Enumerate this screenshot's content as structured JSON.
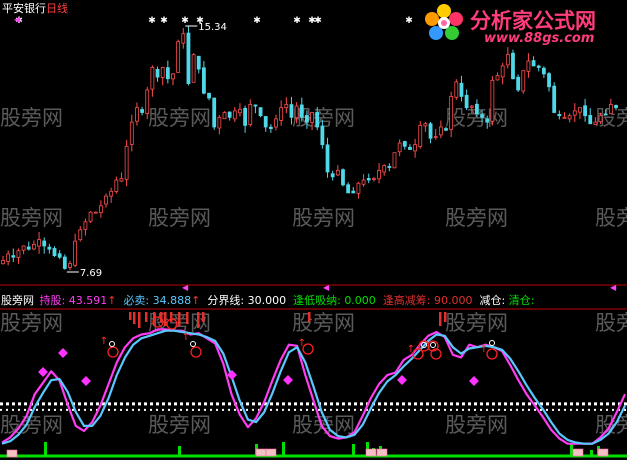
{
  "stock": {
    "name": "平安银行",
    "period": "日线"
  },
  "watermark": {
    "text": "股旁网"
  },
  "logo": {
    "title": "分析家公式网",
    "url": "www.88gs.com"
  },
  "indicator_bar": {
    "source": "股旁网",
    "chi_gu_label": "持股:",
    "chi_gu_value": "43.591",
    "bi_mai_label": "必卖:",
    "bi_mai_value": "34.888",
    "fen_jie_label": "分界线:",
    "fen_jie_value": "30.000",
    "feng_di_label": "逢低吸纳:",
    "feng_di_value": "0.000",
    "feng_gao_label": "逢高减筹:",
    "feng_gao_value": "90.000",
    "jian_cang_label": "减仓:",
    "qing_cang_label": "清仓:",
    "arrow": "↑"
  },
  "colors": {
    "up": "#ff4d4d",
    "down": "#4fd8e8",
    "chi_gu": "#ff3cf2",
    "bi_mai": "#5ac8ff",
    "feng_di": "#00e000",
    "feng_gao": "#e03030",
    "divider": "#c00000"
  },
  "chart_data": [
    {
      "type": "candlestick",
      "title": "",
      "annotations": [
        {
          "label": "15.34",
          "at": "high"
        },
        {
          "label": "7.69",
          "at": "low"
        }
      ],
      "price_range": [
        7.69,
        15.34
      ],
      "close": [
        8.05,
        8.25,
        8.15,
        8.35,
        8.5,
        8.4,
        8.55,
        8.7,
        8.5,
        8.4,
        8.2,
        8.15,
        7.8,
        7.95,
        8.65,
        9.0,
        9.25,
        9.55,
        9.55,
        9.75,
        10.05,
        10.2,
        10.55,
        10.6,
        11.6,
        12.35,
        12.8,
        12.65,
        13.35,
        14.05,
        13.75,
        14.05,
        13.7,
        13.85,
        14.85,
        15.1,
        13.55,
        14.45,
        14.0,
        13.25,
        13.1,
        12.2,
        12.5,
        12.65,
        12.5,
        12.7,
        12.75,
        12.25,
        12.9,
        12.85,
        12.55,
        12.2,
        12.15,
        12.45,
        12.8,
        12.9,
        12.5,
        12.85,
        12.5,
        12.35,
        12.65,
        12.2,
        11.65,
        10.8,
        10.65,
        10.85,
        10.4,
        10.15,
        10.15,
        10.45,
        10.55,
        10.55,
        10.6,
        10.85,
        11.0,
        10.95,
        11.4,
        11.7,
        11.6,
        11.5,
        11.65,
        12.25,
        12.3,
        11.85,
        11.9,
        12.2,
        12.1,
        13.15,
        13.6,
        13.15,
        12.8,
        12.85,
        12.6,
        12.5,
        12.35,
        13.65,
        13.8,
        14.1,
        14.45,
        13.7,
        13.35,
        13.95,
        14.25,
        14.1,
        14.05,
        13.85,
        13.45,
        12.65,
        12.55,
        12.5,
        12.55,
        12.7,
        12.8,
        12.55,
        12.3,
        12.35,
        12.55,
        12.6,
        12.9,
        12.8
      ]
    },
    {
      "type": "line",
      "title": "",
      "ylim": [
        0,
        100
      ],
      "reference_lines": {
        "fen_jie": 30,
        "feng_di": 0,
        "feng_gao": 90
      },
      "series": [
        {
          "name": "持股",
          "values": [
            2,
            6,
            13,
            23,
            40,
            49,
            58,
            51,
            32,
            15,
            11,
            18,
            31,
            48,
            65,
            77,
            84,
            87,
            88,
            91,
            91,
            90,
            90,
            87,
            88,
            84,
            80,
            64,
            40,
            24,
            14,
            21,
            34,
            51,
            67,
            79,
            78,
            55,
            35,
            15,
            7,
            5,
            6,
            10,
            23,
            37,
            48,
            55,
            57,
            67,
            71,
            79,
            86,
            89,
            85,
            71,
            69,
            79,
            77,
            79,
            77,
            74,
            63,
            51,
            40,
            31,
            22,
            12,
            5,
            1,
            1,
            1,
            1,
            6,
            13,
            26,
            40
          ]
        },
        {
          "name": "必卖",
          "values": [
            1,
            3,
            8,
            16,
            30,
            41,
            51,
            52,
            42,
            26,
            15,
            15,
            23,
            37,
            55,
            69,
            79,
            84,
            86,
            88,
            90,
            90,
            89,
            88,
            87,
            85,
            82,
            72,
            54,
            35,
            20,
            18,
            26,
            41,
            58,
            73,
            77,
            65,
            46,
            26,
            12,
            7,
            6,
            8,
            16,
            29,
            41,
            50,
            55,
            62,
            68,
            75,
            82,
            87,
            86,
            77,
            72,
            76,
            77,
            78,
            77,
            75,
            68,
            58,
            47,
            37,
            28,
            18,
            9,
            4,
            2,
            1,
            1,
            4,
            9,
            18,
            31
          ]
        }
      ]
    }
  ]
}
